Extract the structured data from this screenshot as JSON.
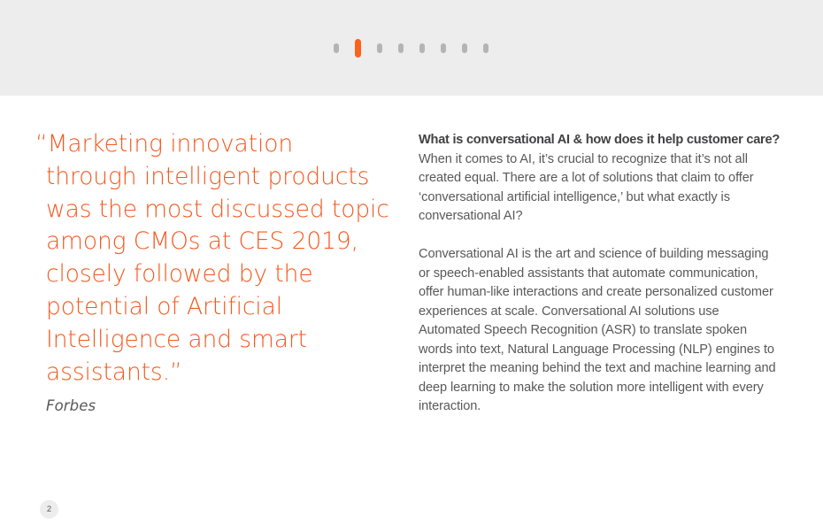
{
  "theme": {
    "accent_color": "#f4591f",
    "topbar_background": "#ededed",
    "body_text_color": "#58585a",
    "heading_text_color": "#414042",
    "inactive_dot_color": "#b4b4b4",
    "page_background": "#ffffff"
  },
  "pager": {
    "total": 8,
    "active_index": 1,
    "dots": [
      {
        "index": 0,
        "label": "1",
        "active": false
      },
      {
        "index": 1,
        "label": "2",
        "active": true
      },
      {
        "index": 2,
        "label": "3",
        "active": false
      },
      {
        "index": 3,
        "label": "4",
        "active": false
      },
      {
        "index": 4,
        "label": "5",
        "active": false
      },
      {
        "index": 5,
        "label": "6",
        "active": false
      },
      {
        "index": 6,
        "label": "7",
        "active": false
      },
      {
        "index": 7,
        "label": "8",
        "active": false
      }
    ]
  },
  "quote": {
    "text": "“Marketing innovation through intelligent products was the most discussed topic among CMOs at CES 2019, closely followed by the potential of Artificial Intelligence and smart assistants.”",
    "attribution": "Forbes"
  },
  "article": {
    "heading": "What is conversational AI & how does it help customer care?",
    "paragraphs": [
      "When it comes to AI, it’s crucial to recognize that it’s not all created equal. There are a lot of solutions that claim to offer ‘conversational artificial intelligence,’ but what exactly is conversational AI?",
      "Conversational AI is the art and science of building messaging or speech-enabled assistants that automate communication, offer human-like interactions and create personalized customer experiences at scale. Conversational AI solutions use Automated Speech Recognition (ASR) to translate spoken words into text, Natural Language Processing (NLP) engines to interpret the meaning behind the text and machine learning and deep learning to make the solution more intelligent with every interaction."
    ]
  },
  "footer": {
    "page_number": "2"
  }
}
